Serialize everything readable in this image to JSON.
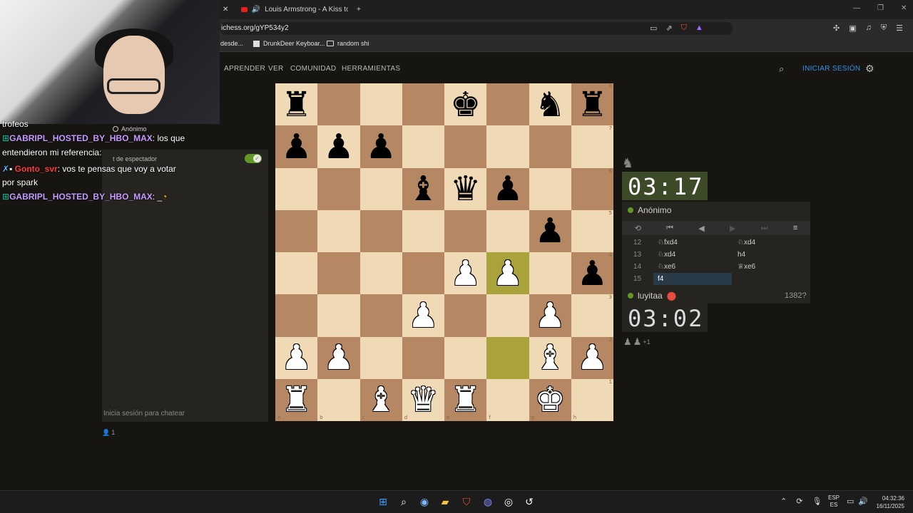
{
  "browser": {
    "tab_title": "Louis Armstrong - A Kiss to Bu",
    "url": "ichess.org/gYP534y2",
    "bookmarks": [
      "desde...",
      "DrunkDeer Keyboar...",
      "random shi"
    ],
    "colors": {
      "tabbar": "#1f1f1f",
      "urlbar": "#2b2b2b"
    }
  },
  "nav": {
    "links": [
      "APRENDER",
      "VER",
      "COMUNIDAD",
      "HERRAMIENTAS"
    ],
    "signin": "INICIAR SESIÓN"
  },
  "chat_overlay": {
    "lines": [
      {
        "user": "",
        "text": "trofeos"
      },
      {
        "user": "GABRIPL_HOSTED_BY_HBO_MAX",
        "text": " los que"
      },
      {
        "user": "",
        "text": "entendieron mi referencia"
      },
      {
        "user": "Gonto_svr",
        "text": " vos te pensas que voy a votar"
      },
      {
        "user": "",
        "text": "por spark"
      },
      {
        "user": "GABRIPL_HOSTED_BY_HBO_MAX",
        "text": " _"
      }
    ]
  },
  "lichess_chat": {
    "anon_label": "Anónimo",
    "spectator_label": "t de espectador",
    "input_placeholder": "Inicia sesión para chatear",
    "viewer_count": "1"
  },
  "board": {
    "files": [
      "a",
      "b",
      "c",
      "d",
      "e",
      "f",
      "g",
      "h"
    ],
    "ranks": [
      "8",
      "7",
      "6",
      "5",
      "4",
      "3",
      "2",
      "1"
    ],
    "highlight_squares": [
      "f4",
      "f2"
    ],
    "position": [
      [
        "r",
        "",
        "",
        "",
        "k",
        "",
        "n",
        "r"
      ],
      [
        "p",
        "p",
        "p",
        "",
        "",
        "",
        "",
        ""
      ],
      [
        "",
        "",
        "",
        "b",
        "q",
        "p",
        "",
        ""
      ],
      [
        "",
        "",
        "",
        "",
        "",
        "",
        "p",
        ""
      ],
      [
        "",
        "",
        "",
        "",
        "P",
        "P",
        "",
        "p"
      ],
      [
        "",
        "",
        "",
        "P",
        "",
        "",
        "P",
        ""
      ],
      [
        "P",
        "P",
        "",
        "",
        "",
        "",
        "B",
        "P"
      ],
      [
        "R",
        "",
        "B",
        "Q",
        "R",
        "",
        "K",
        ""
      ]
    ],
    "colors": {
      "light": "#f0d9b5",
      "dark": "#b58863",
      "highlight": "#aaa23a"
    }
  },
  "game": {
    "top_clock": "03:17",
    "top_player": "Anónimo",
    "bottom_clock": "03:02",
    "bottom_player": "luyitaa",
    "bottom_rating": "1382?",
    "material": "+1",
    "moves": [
      {
        "num": "12",
        "white": "♘fxd4",
        "black": "♘xd4"
      },
      {
        "num": "13",
        "white": "♘xd4",
        "black": "h4"
      },
      {
        "num": "14",
        "white": "♘xe6",
        "black": "♕xe6"
      },
      {
        "num": "15",
        "white": "f4",
        "black": ""
      }
    ]
  },
  "taskbar": {
    "lang_top": "ESP",
    "lang_bottom": "ES",
    "time": "04:32:36",
    "date": "16/11/2025"
  }
}
